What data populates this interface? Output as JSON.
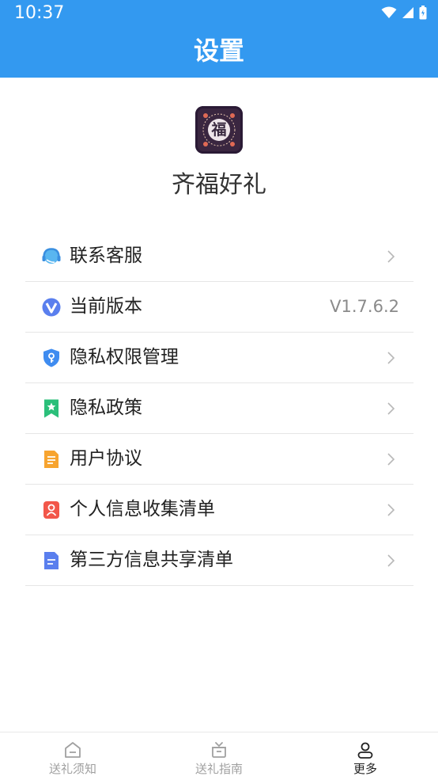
{
  "status_bar": {
    "time": "10:37"
  },
  "header": {
    "title": "设置"
  },
  "app": {
    "name": "齐福好礼",
    "logo_char": "福"
  },
  "menu": {
    "items": [
      {
        "label": "联系客服",
        "icon": "headset-icon"
      },
      {
        "label": "当前版本",
        "icon": "version-icon",
        "value": "V1.7.6.2"
      },
      {
        "label": "隐私权限管理",
        "icon": "shield-icon"
      },
      {
        "label": "隐私政策",
        "icon": "bookmark-icon"
      },
      {
        "label": "用户协议",
        "icon": "document-icon"
      },
      {
        "label": "个人信息收集清单",
        "icon": "person-card-icon"
      },
      {
        "label": "第三方信息共享清单",
        "icon": "file-icon"
      }
    ]
  },
  "tabbar": {
    "tabs": [
      {
        "label": "送礼须知",
        "icon": "home-icon",
        "active": false
      },
      {
        "label": "送礼指南",
        "icon": "gift-icon",
        "active": false
      },
      {
        "label": "更多",
        "icon": "user-icon",
        "active": true
      }
    ]
  },
  "colors": {
    "header": "#3399f0",
    "active_tab": "#222222",
    "inactive_tab": "#a0a0a0"
  }
}
